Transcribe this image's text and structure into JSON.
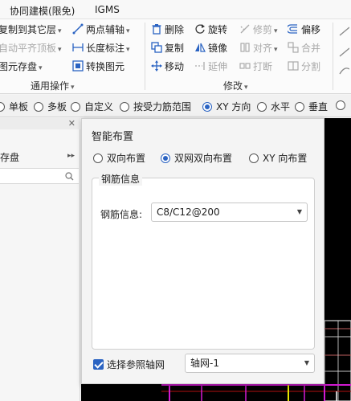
{
  "tabs": {
    "collab": "协同建模(限免)",
    "igms": "IGMS"
  },
  "ribbon": {
    "col1": [
      "复制到其它层",
      "自动平齐顶板",
      "图元存盘"
    ],
    "col2": [
      "两点辅轴",
      "长度标注",
      "转换图元"
    ],
    "edit_col1": [
      "删除",
      "复制",
      "移动"
    ],
    "edit_col2": [
      "旋转",
      "镜像",
      "延伸"
    ],
    "edit_col3": [
      "修剪",
      "对齐",
      "打断"
    ],
    "edit_col4": [
      "偏移",
      "合并",
      "分割"
    ],
    "group_general": "通用操作",
    "group_modify": "修改"
  },
  "options_bar": {
    "items": [
      "单板",
      "多板",
      "自定义",
      "按受力筋范围",
      "XY 方向",
      "水平",
      "垂直"
    ],
    "selected": "XY 方向"
  },
  "left_panel": {
    "close": "✕",
    "item": "存盘"
  },
  "dialog": {
    "title": "智能布置",
    "layout_options": [
      "双向布置",
      "双网双向布置",
      "XY 向布置"
    ],
    "selected_layout": "双网双向布置",
    "group_title": "钢筋信息",
    "rebar_label": "钢筋信息:",
    "rebar_value": "C8/C12@200",
    "checkbox_label": "选择参照轴网",
    "checkbox_checked": true,
    "axis_value": "轴网-1"
  },
  "colors": {
    "accent": "#2a63c2",
    "canvas": "#000000",
    "magenta": "#d21ad2",
    "yellow": "#e6e600"
  }
}
